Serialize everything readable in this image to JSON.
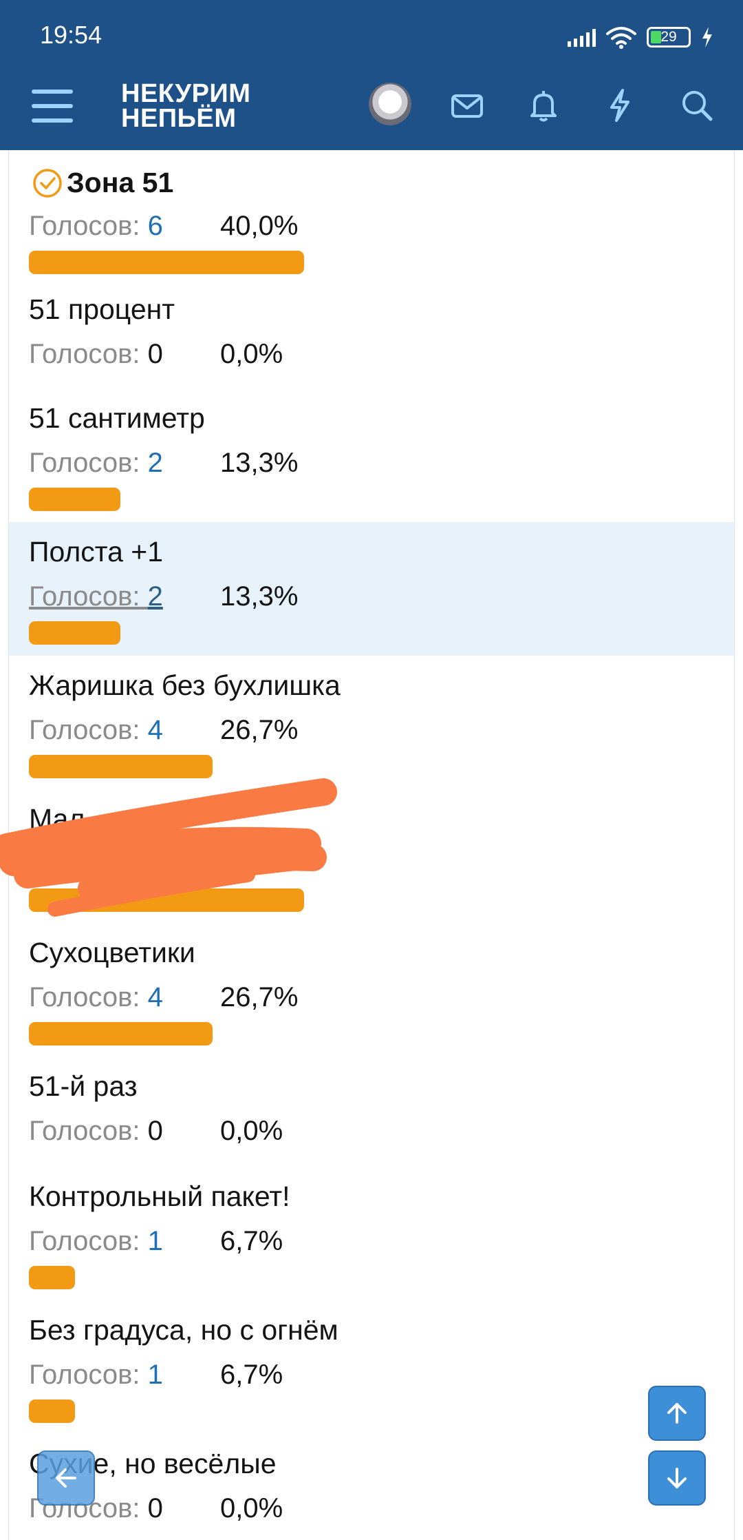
{
  "status_bar": {
    "time": "19:54",
    "battery_level": "29",
    "battery_fraction": 0.29
  },
  "header": {
    "logo_line1": "НЕКУРИМ",
    "logo_line2": "НЕПЬЁМ",
    "icons": [
      "menu-icon",
      "avatar",
      "mail-icon",
      "bell-icon",
      "lightning-icon",
      "search-icon"
    ]
  },
  "poll": {
    "items": [
      {
        "title": "Зона 51",
        "label": "Голосов:",
        "count": "6",
        "percent": "40,0%",
        "share": 0.4,
        "voted": true
      },
      {
        "title": "51 процент",
        "label": "Голосов:",
        "count": "0",
        "percent": "0,0%",
        "share": 0.0
      },
      {
        "title": "51 сантиметр",
        "label": "Голосов:",
        "count": "2",
        "percent": "13,3%",
        "share": 0.133
      },
      {
        "title": "Полста +1",
        "label": "Голосов:",
        "count": "2",
        "percent": "13,3%",
        "share": 0.133,
        "highlighted": true
      },
      {
        "title": "Жаришка без бухлишка",
        "label": "Голосов:",
        "count": "4",
        "percent": "26,7%",
        "share": 0.267
      },
      {
        "title": "Мал",
        "label": "",
        "count": "",
        "percent": "",
        "share": 0.4,
        "redacted": true
      },
      {
        "title": "Сухоцветики",
        "label": "Голосов:",
        "count": "4",
        "percent": "26,7%",
        "share": 0.267
      },
      {
        "title": "51-й раз",
        "label": "Голосов:",
        "count": "0",
        "percent": "0,0%",
        "share": 0.0
      },
      {
        "title": "Контрольный пакет!",
        "label": "Голосов:",
        "count": "1",
        "percent": "6,7%",
        "share": 0.067
      },
      {
        "title": "Без градуса, но с огнём",
        "label": "Голосов:",
        "count": "1",
        "percent": "6,7%",
        "share": 0.067
      },
      {
        "title": "Сухие, но весёлые",
        "label": "Голосов:",
        "count": "0",
        "percent": "0,0%",
        "share": 0.0
      }
    ]
  },
  "colors": {
    "header_bg": "#1d5188",
    "bar": "#f39a15",
    "highlight_row": "#e7f2fb",
    "vote_link": "#1f6fb5",
    "redaction": "#f97a43"
  },
  "floating_buttons": [
    "scroll-up-icon",
    "scroll-down-icon",
    "back-arrow-icon"
  ]
}
